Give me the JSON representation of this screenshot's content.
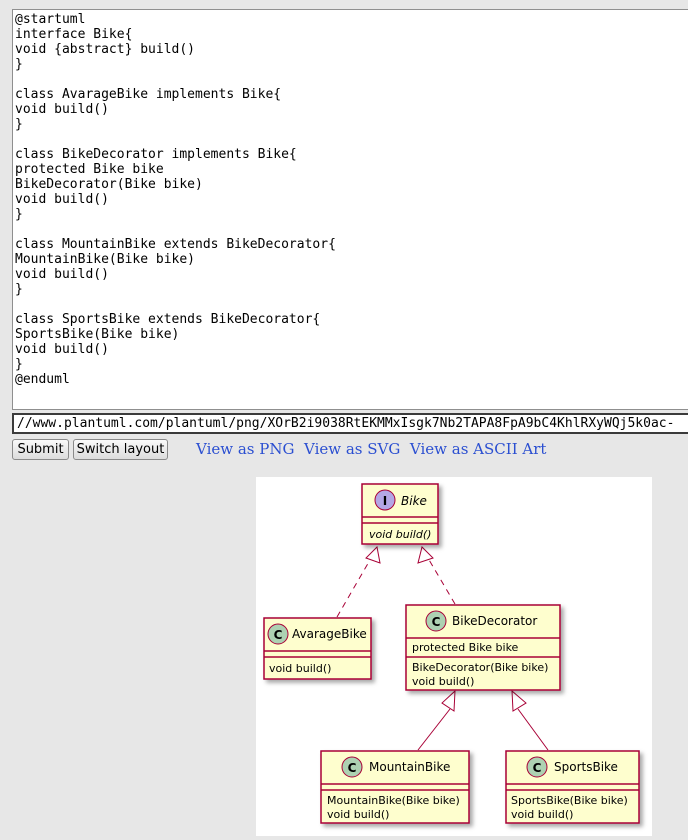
{
  "editor": {
    "source": "@startuml\ninterface Bike{\nvoid {abstract} build()\n}\n\nclass AvarageBike implements Bike{\nvoid build()\n}\n\nclass BikeDecorator implements Bike{\nprotected Bike bike\nBikeDecorator(Bike bike)\nvoid build()\n}\n\nclass MountainBike extends BikeDecorator{\nMountainBike(Bike bike)\nvoid build()\n}\n\nclass SportsBike extends BikeDecorator{\nSportsBike(Bike bike)\nvoid build()\n}\n@enduml",
    "url": "//www.plantuml.com/plantuml/png/XOrB2i9038RtEKMMxIsgk7Nb2TAPA8FpA9bC4KhlRXyWQj5k0ac-"
  },
  "buttons": {
    "submit": "Submit",
    "switch_layout": "Switch layout"
  },
  "links": {
    "png": "View as PNG",
    "svg": "View as SVG",
    "ascii": "View as ASCII Art"
  },
  "diagram": {
    "bike": {
      "stereotype": "I",
      "name": "Bike",
      "method": "void build()"
    },
    "avarage": {
      "stereotype": "C",
      "name": "AvarageBike",
      "method": "void build()"
    },
    "decorator": {
      "stereotype": "C",
      "name": "BikeDecorator",
      "field": "protected Bike bike",
      "ctor": "BikeDecorator(Bike bike)",
      "method": "void build()"
    },
    "mountain": {
      "stereotype": "C",
      "name": "MountainBike",
      "ctor": "MountainBike(Bike bike)",
      "method": "void build()"
    },
    "sports": {
      "stereotype": "C",
      "name": "SportsBike",
      "ctor": "SportsBike(Bike bike)",
      "method": "void build()"
    },
    "colors": {
      "class_fill": "#fefece",
      "border": "#a80036",
      "interface_circle": "#b4a7e5",
      "class_circle": "#add1b2"
    }
  }
}
